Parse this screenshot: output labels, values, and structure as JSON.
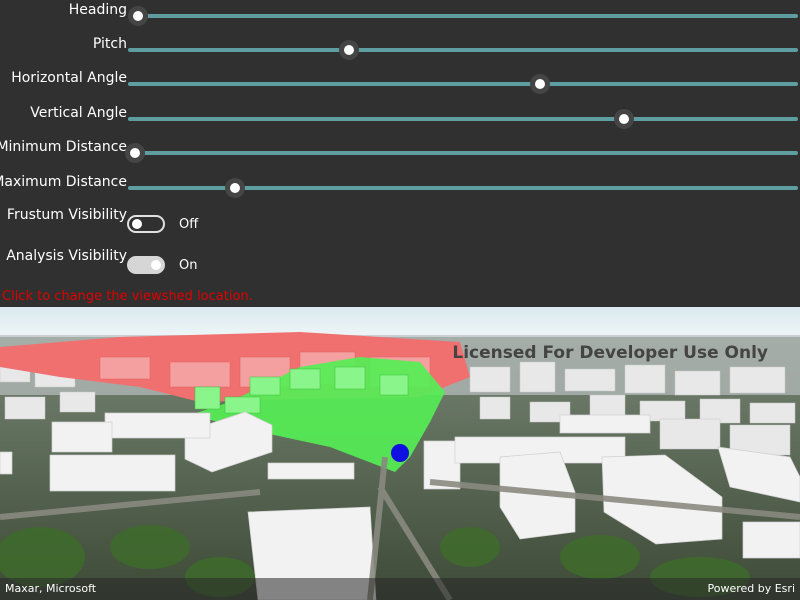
{
  "controls": {
    "sliders": [
      {
        "label": "Heading",
        "value_fraction": 0.015
      },
      {
        "label": "Pitch",
        "value_fraction": 0.33
      },
      {
        "label": "Horizontal Angle",
        "value_fraction": 0.615
      },
      {
        "label": "Vertical Angle",
        "value_fraction": 0.74
      },
      {
        "label": "Minimum Distance",
        "value_fraction": 0.01
      },
      {
        "label": "Maximum Distance",
        "value_fraction": 0.16
      }
    ],
    "toggles": [
      {
        "label": "Frustum Visibility",
        "state": "Off",
        "checked": false
      },
      {
        "label": "Analysis Visibility",
        "state": "On",
        "checked": true
      }
    ],
    "hint": "Click to change the viewshed location."
  },
  "map": {
    "watermark": "Licensed For Developer Use Only",
    "attribution_left": "Maxar, Microsoft",
    "attribution_right": "Powered by Esri",
    "colors": {
      "visible": "#55ee55",
      "not_visible": "#f07070",
      "observer": "#1010e0",
      "track": "#5f9ea0"
    }
  }
}
